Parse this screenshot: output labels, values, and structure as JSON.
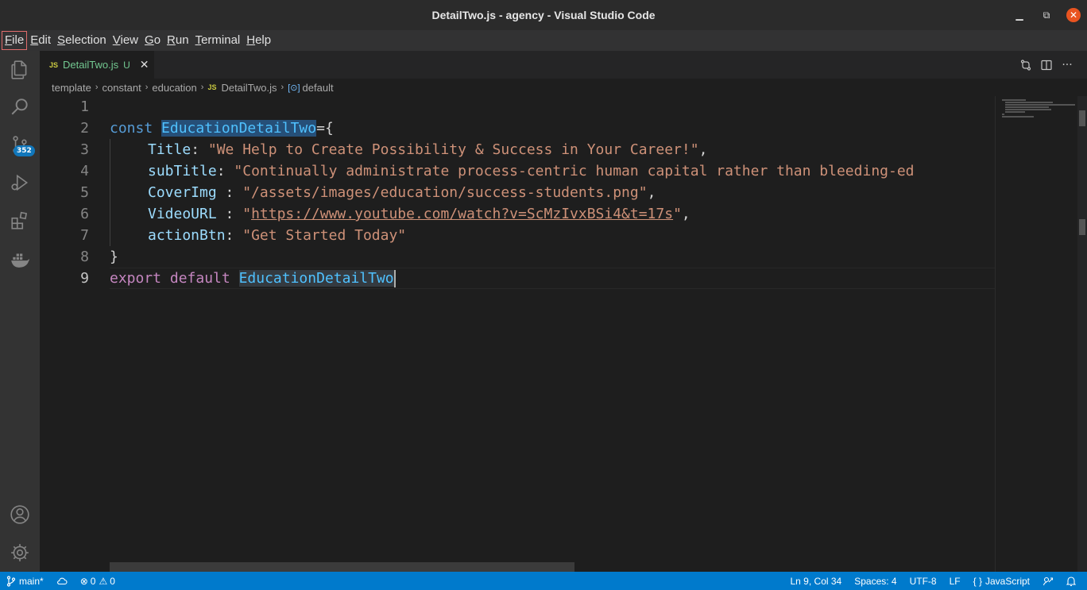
{
  "window": {
    "title": "DetailTwo.js - agency - Visual Studio Code",
    "minimize_icon": "minimize-icon",
    "maximize_icon": "maximize-icon",
    "close_icon": "close-icon"
  },
  "menubar": {
    "items": [
      {
        "label": "File",
        "mnemonic": "F",
        "rest": "ile"
      },
      {
        "label": "Edit",
        "mnemonic": "E",
        "rest": "dit"
      },
      {
        "label": "Selection",
        "mnemonic": "S",
        "rest": "election"
      },
      {
        "label": "View",
        "mnemonic": "V",
        "rest": "iew"
      },
      {
        "label": "Go",
        "mnemonic": "G",
        "rest": "o"
      },
      {
        "label": "Run",
        "mnemonic": "R",
        "rest": "un"
      },
      {
        "label": "Terminal",
        "mnemonic": "T",
        "rest": "erminal"
      },
      {
        "label": "Help",
        "mnemonic": "H",
        "rest": "elp"
      }
    ]
  },
  "activitybar": {
    "icons": [
      "explorer-icon",
      "search-icon",
      "source-control-icon",
      "run-debug-icon",
      "extensions-icon",
      "docker-icon",
      "accounts-icon",
      "manage-gear-icon"
    ],
    "source_control_badge": "352"
  },
  "tab": {
    "lang_badge": "JS",
    "filename": "DetailTwo.js",
    "status": "U",
    "close": "✕"
  },
  "breadcrumb": {
    "parts": [
      "template",
      "constant",
      "education"
    ],
    "file_badge": "JS",
    "file": "DetailTwo.js",
    "symbol_icon": "[⊙]",
    "symbol": "default"
  },
  "editor": {
    "line_numbers": [
      "1",
      "2",
      "3",
      "4",
      "5",
      "6",
      "7",
      "8",
      "9"
    ],
    "line2": {
      "kw": "const",
      "name": "EducationDetailTwo",
      "rest": "={"
    },
    "line3": {
      "key": "Title",
      "sep": ": ",
      "value": "\"We Help to Create Possibility & Success in Your Career!\"",
      "end": ","
    },
    "line4": {
      "key": "subTitle",
      "sep": ": ",
      "value": "\"Continually administrate process-centric human capital rather than bleeding-ed"
    },
    "line5": {
      "key": "CoverImg",
      "sep": " : ",
      "value": "\"/assets/images/education/success-students.png\"",
      "end": ","
    },
    "line6": {
      "key": "VideoURL",
      "sep": " : ",
      "quote_open": "\"",
      "url": "https://www.youtube.com/watch?v=ScMzIvxBSi4&t=17s",
      "quote_close": "\"",
      "end": ","
    },
    "line7": {
      "key": "actionBtn",
      "sep": ": ",
      "value": "\"Get Started Today\""
    },
    "line8": {
      "text": "}"
    },
    "line9": {
      "kw1": "export",
      "kw2": "default",
      "name": "EducationDetailTwo"
    }
  },
  "statusbar": {
    "branch": "main*",
    "sync_icon": "sync-icon",
    "errors": "0",
    "warnings": "0",
    "position": "Ln 9, Col 34",
    "spaces": "Spaces: 4",
    "encoding": "UTF-8",
    "eol": "LF",
    "language": "JavaScript",
    "feedback_icon": "feedback-icon",
    "bell_icon": "bell-icon"
  },
  "colors": {
    "accent": "#007acc",
    "keyword": "#569cd6",
    "string": "#ce9178",
    "property": "#9cdcfe"
  }
}
